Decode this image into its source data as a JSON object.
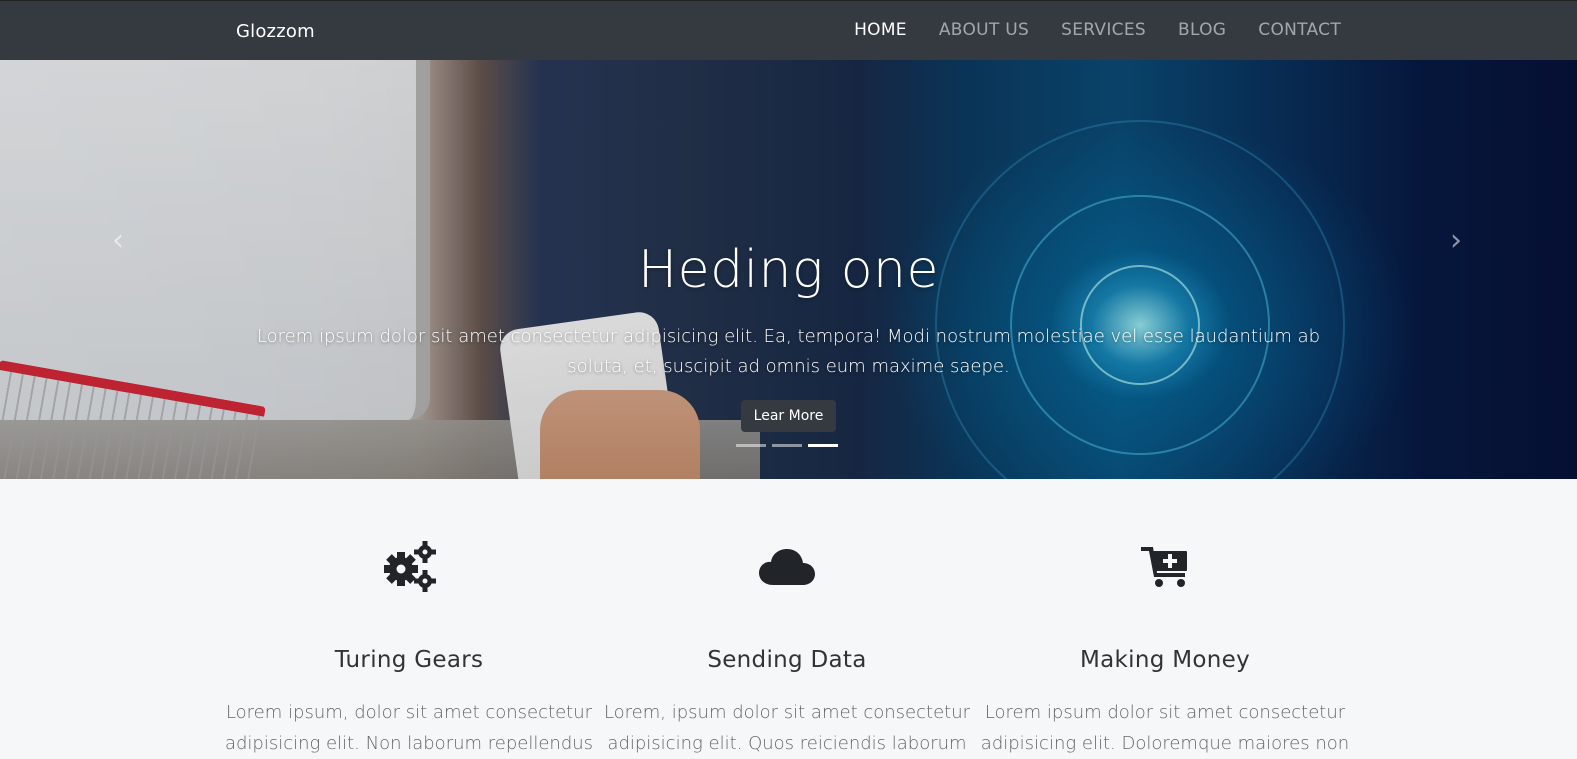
{
  "navbar": {
    "brand": "Glozzom",
    "links": [
      {
        "label": "HOME"
      },
      {
        "label": "ABOUT US"
      },
      {
        "label": "SERVICES"
      },
      {
        "label": "BLOG"
      },
      {
        "label": "CONTACT"
      }
    ],
    "active": "HOME"
  },
  "hero": {
    "title": "Heding one",
    "text": "Lorem ipsum dolor sit amet consectetur adipisicing elit. Ea, tempora! Modi nostrum molestiae vel esse laudantium ab soluta, et, suscipit ad omnis eum maxime saepe.",
    "button": "Lear More",
    "slide_count": 3,
    "active_slide": 3,
    "prev_icon": "chevron-left-icon",
    "next_icon": "chevron-right-icon"
  },
  "features": [
    {
      "icon": "gears-icon",
      "title": "Turing Gears",
      "text": "Lorem ipsum, dolor sit amet consectetur adipisicing elit. Non laborum repellendus"
    },
    {
      "icon": "cloud-icon",
      "title": "Sending Data",
      "text": "Lorem, ipsum dolor sit amet consectetur adipisicing elit. Quos reiciendis laborum"
    },
    {
      "icon": "cart-plus-icon",
      "title": "Making Money",
      "text": "Lorem ipsum dolor sit amet consectetur adipisicing elit. Doloremque maiores non"
    }
  ],
  "colors": {
    "navbar_bg": "#343a40",
    "page_bg": "#f6f7f9",
    "button_bg": "#343a40",
    "icon_color": "#212529"
  }
}
